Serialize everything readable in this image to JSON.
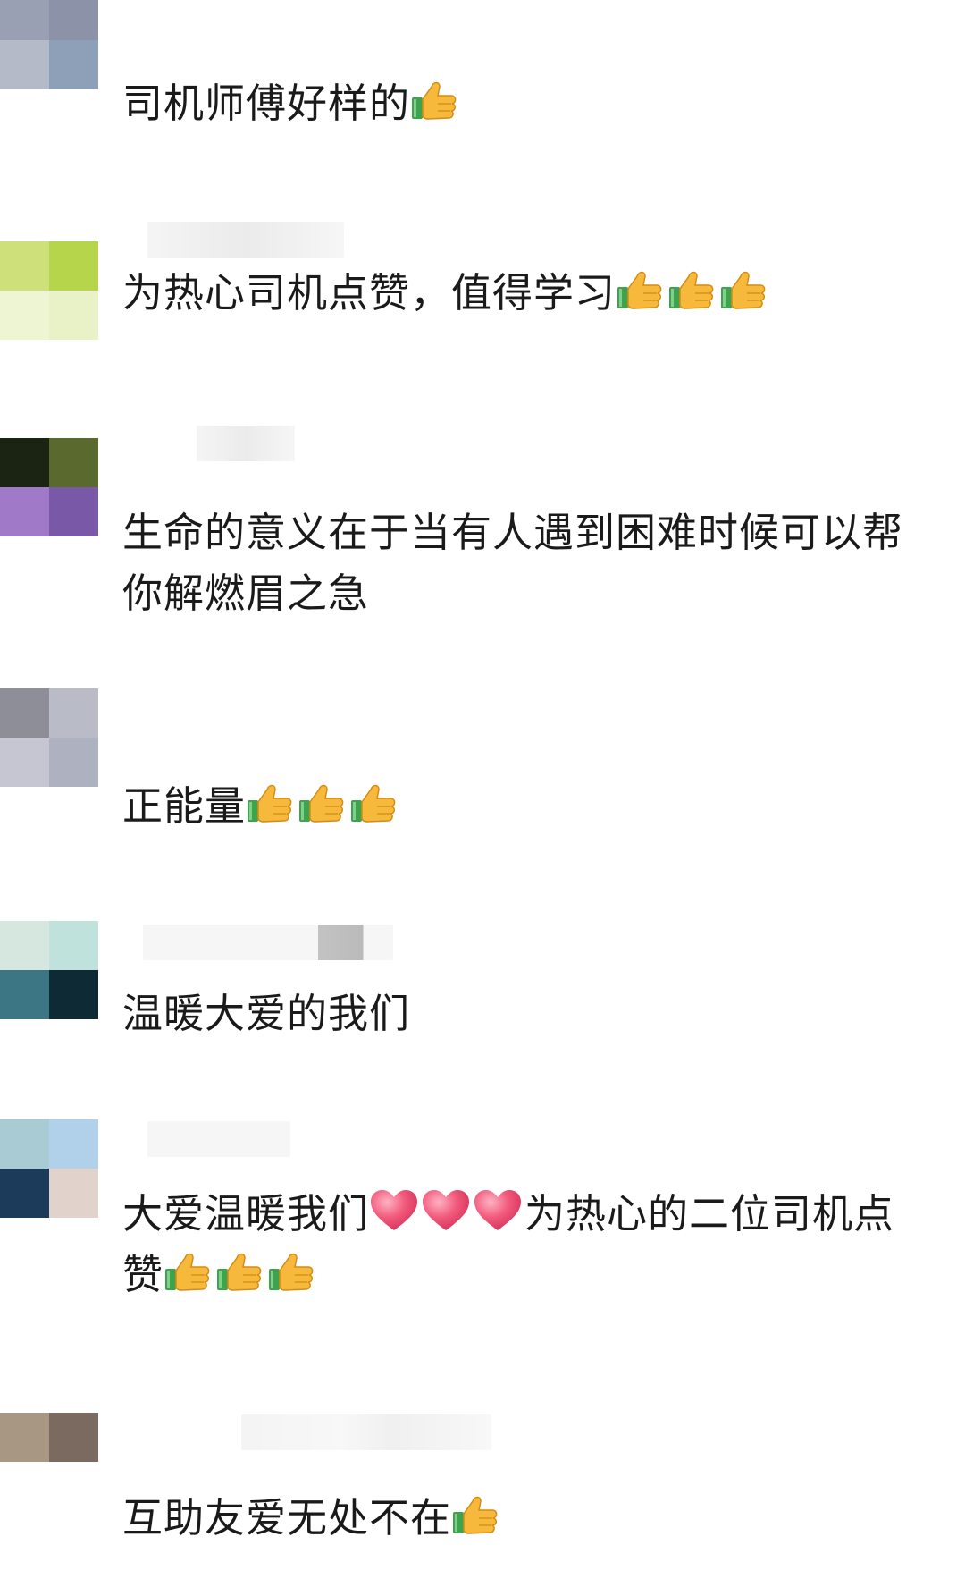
{
  "comments": [
    {
      "avatar_colors": [
        "#9aa0b4",
        "#8c93a8",
        "#b5bac8",
        "#8ea0b8"
      ],
      "text": "司机师傅好样的",
      "trailing_icons": [
        "thumbs-up"
      ]
    },
    {
      "avatar_colors": [
        "#cde07a",
        "#b7d54a",
        "#eef5d2",
        "#e8f2c6"
      ],
      "text": "为热心司机点赞，值得学习",
      "trailing_icons": [
        "thumbs-up",
        "thumbs-up",
        "thumbs-up"
      ]
    },
    {
      "avatar_colors": [
        "#1b2412",
        "#5a6a2f",
        "#a079c9",
        "#7a58a8"
      ],
      "text": "生命的意义在于当有人遇到困难时候可以帮你解燃眉之急",
      "trailing_icons": []
    },
    {
      "avatar_colors": [
        "#8e8e98",
        "#b9bbc7",
        "#c5c6d1",
        "#aeb1bf"
      ],
      "text": "正能量",
      "trailing_icons": [
        "thumbs-up",
        "thumbs-up",
        "thumbs-up"
      ]
    },
    {
      "avatar_colors": [
        "#d5e7df",
        "#bfe3dc",
        "#3c7584",
        "#0e2b35"
      ],
      "text": "温暖大爱的我们",
      "trailing_icons": []
    },
    {
      "avatar_colors": [
        "#a9ccd4",
        "#b1d1ea",
        "#1c3a5a",
        "#e1d3cc"
      ],
      "text_before_hearts": "大爱温暖我们",
      "hearts": 3,
      "text_after_hearts": "为热心的二位司机点赞",
      "trailing_icons": [
        "thumbs-up",
        "thumbs-up",
        "thumbs-up"
      ]
    },
    {
      "avatar_colors": [
        "#a89783",
        "#7b6a60",
        "#ffffff",
        "#ffffff"
      ],
      "text": "互助友爱无处不在",
      "trailing_icons": [
        "thumbs-up"
      ]
    }
  ],
  "icon_colors": {
    "thumb_yellow": "#f6b93b",
    "thumb_outline": "#d48c14",
    "cuff_green": "#3fa34d",
    "heart_pink": "#f25a7c"
  }
}
